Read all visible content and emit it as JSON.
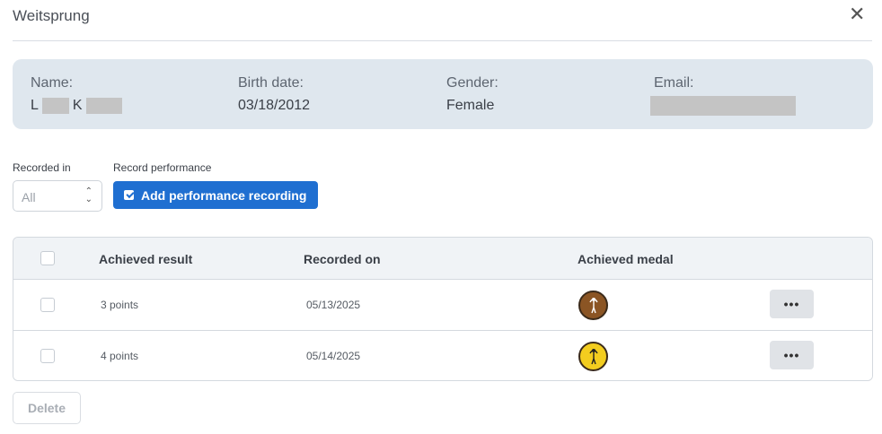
{
  "dialog": {
    "title": "Weitsprung"
  },
  "athlete": {
    "name_label": "Name:",
    "name_initial_first": "L",
    "name_initial_last": "K",
    "birth_label": "Birth date:",
    "birth_value": "03/18/2012",
    "gender_label": "Gender:",
    "gender_value": "Female",
    "email_label": "Email:"
  },
  "filters": {
    "recorded_in_label": "Recorded in",
    "recorded_in_value": "All",
    "record_perf_label": "Record performance",
    "add_button_label": "Add performance recording"
  },
  "table": {
    "headers": [
      "Achieved result",
      "Recorded on",
      "Achieved medal"
    ],
    "rows": [
      {
        "result": "3 points",
        "date": "05/13/2025",
        "medal": "bronze",
        "medal_color": "#8b5524"
      },
      {
        "result": "4 points",
        "date": "05/14/2025",
        "medal": "gold",
        "medal_color": "#f3cd1f"
      }
    ],
    "more_label": "•••"
  },
  "footer": {
    "delete_label": "Delete"
  },
  "icons": {
    "close": "close-icon",
    "select_arrows": "chevron-updown-icon",
    "add": "edit-check-icon",
    "medal": "jump-rope-athlete-icon"
  }
}
